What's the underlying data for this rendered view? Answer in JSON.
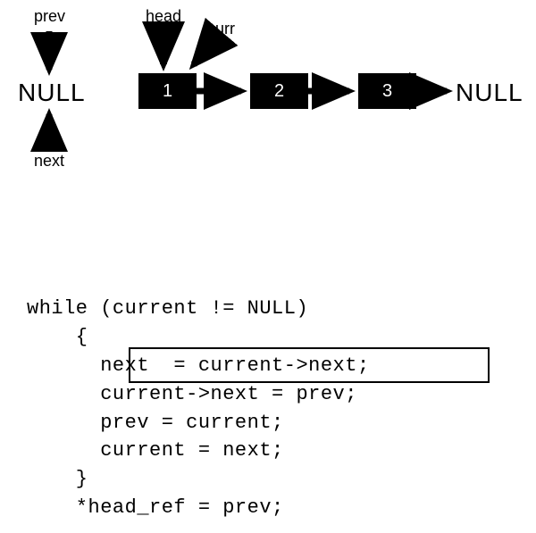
{
  "diagram": {
    "labels": {
      "prev": "prev",
      "head": "head",
      "curr": "curr",
      "next": "next"
    },
    "null_left": "NULL",
    "null_right": "NULL",
    "nodes": [
      "1",
      "2",
      "3"
    ]
  },
  "code": {
    "l1": "while (current != NULL)",
    "l2": "    {",
    "l3": "      next  = current->next;",
    "l4": "      current->next = prev;",
    "l5": "      prev = current;",
    "l6": "      current = next;",
    "l7": "    }",
    "l8": "    *head_ref = prev;"
  }
}
